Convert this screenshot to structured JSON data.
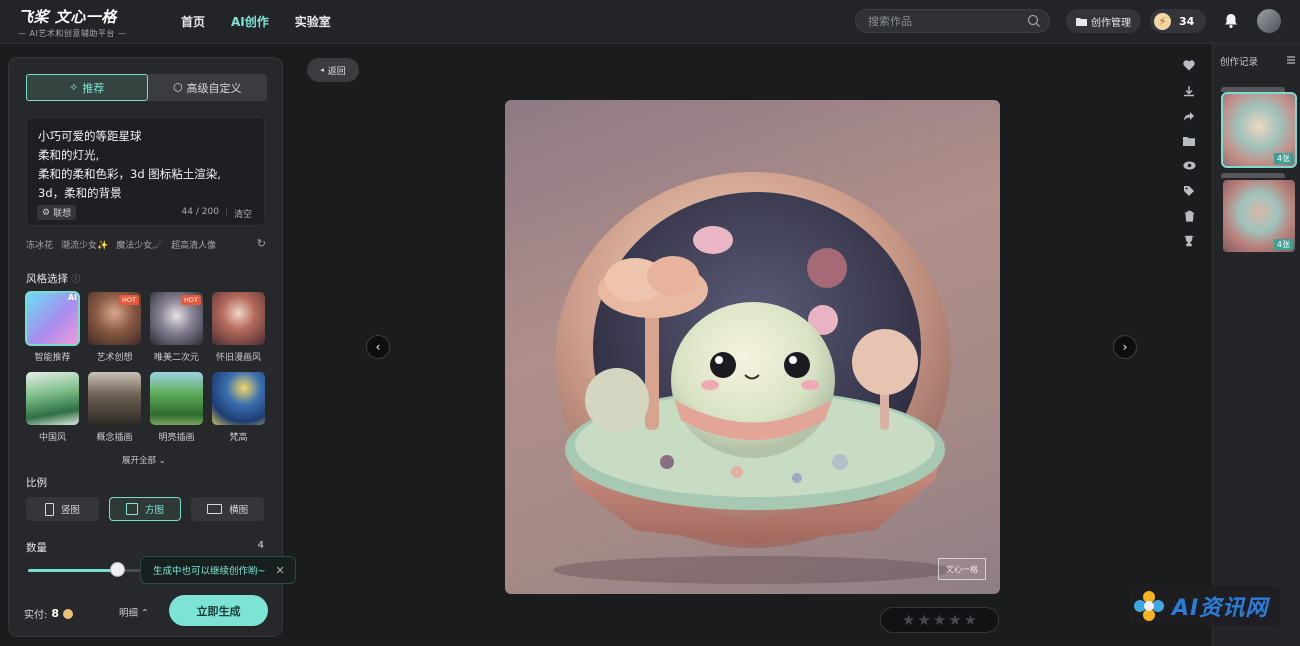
{
  "header": {
    "logo_text": "飞桨 文心一格",
    "logo_sub": "— AI艺术和创意辅助平台 —",
    "nav": [
      "首页",
      "AI创作",
      "实验室"
    ],
    "active_nav": 1,
    "search_placeholder": "搜索作品",
    "manage_label": "创作管理",
    "credits": "34"
  },
  "left_panel": {
    "tabs": [
      "推荐",
      "高级自定义"
    ],
    "active_tab": 0,
    "prompt": "小巧可爱的等距星球\n柔和的灯光,\n柔和的柔和色彩，3d 图标粘土渲染,\n3d，柔和的背景",
    "assoc_label": "联想",
    "counter": "44 / 200",
    "clear_label": "清空",
    "suggestions": [
      "冻冰花",
      "潮流少女✨",
      "魔法少女,☄",
      "超高清人像"
    ],
    "style_label": "风格选择",
    "styles": [
      {
        "name": "智能推荐",
        "badge": "AI"
      },
      {
        "name": "艺术创想",
        "badge": "HOT"
      },
      {
        "name": "唯美二次元",
        "badge": "HOT"
      },
      {
        "name": "怀旧漫画风",
        "badge": ""
      },
      {
        "name": "中国风",
        "badge": ""
      },
      {
        "name": "概念插画",
        "badge": ""
      },
      {
        "name": "明亮插画",
        "badge": ""
      },
      {
        "name": "梵高",
        "badge": ""
      }
    ],
    "expand_label": "展开全部",
    "ratio_label": "比例",
    "ratios": [
      "竖图",
      "方图",
      "横图"
    ],
    "active_ratio": 1,
    "qty_label": "数量",
    "qty_value": "4",
    "qty_fraction": 0.375,
    "pay_label": "实付:",
    "pay_value": "8",
    "detail_label": "明细",
    "generate_label": "立即生成"
  },
  "toast": {
    "text": "生成中也可以继续创作哟~"
  },
  "center": {
    "back_label": "返回",
    "watermark": "文心一格",
    "rating_stars": 5
  },
  "history": {
    "title": "创作记录",
    "items": [
      {
        "count": "4张",
        "active": true
      },
      {
        "count": "4张",
        "active": false
      }
    ]
  },
  "watermark_brand": "AI资讯网",
  "colors": {
    "accent": "#7fe6d9",
    "bg": "#1b1c1e",
    "panel": "#27282b"
  }
}
